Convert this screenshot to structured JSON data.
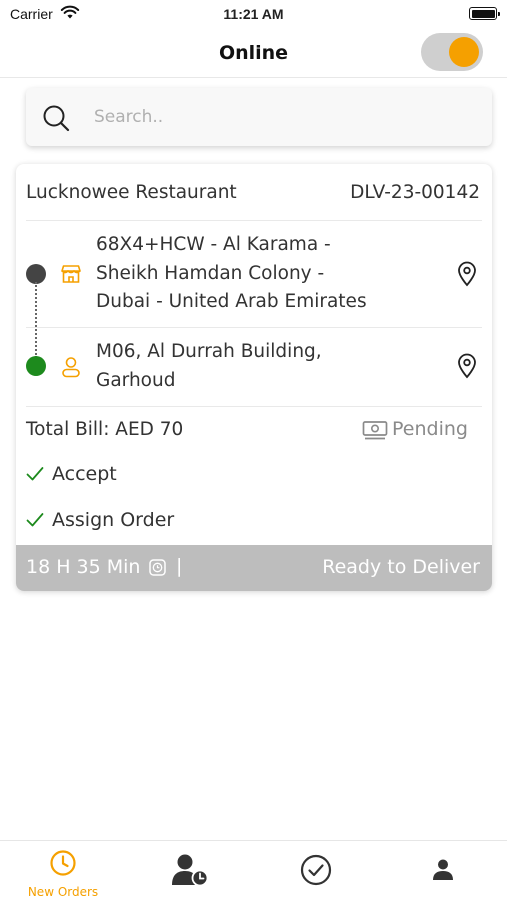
{
  "status_bar": {
    "carrier": "Carrier",
    "time": "11:21 AM"
  },
  "header": {
    "title": "Online",
    "toggle_on": true
  },
  "search": {
    "placeholder": "Search.."
  },
  "order": {
    "restaurant": "Lucknowee Restaurant",
    "order_id": "DLV-23-00142",
    "pickup_address_lines": [
      "68X4+HCW - Al Karama -",
      "Sheikh Hamdan Colony -",
      "Dubai - United Arab Emirates"
    ],
    "drop_address_lines": [
      "M06, Al Durrah Building,",
      "Garhoud"
    ],
    "total_bill": "Total Bill: AED 70",
    "payment_status": "Pending",
    "actions": [
      "Accept",
      "Assign Order"
    ],
    "elapsed_time": "18 H 35 Min",
    "separator": "|",
    "delivery_status": "Ready to Deliver"
  },
  "bottom_nav": {
    "items": [
      {
        "label": "New Orders",
        "icon": "clock-icon",
        "active": true
      },
      {
        "label": "",
        "icon": "user-clock-icon",
        "active": false
      },
      {
        "label": "",
        "icon": "check-circle-icon",
        "active": false
      },
      {
        "label": "",
        "icon": "person-icon",
        "active": false
      }
    ]
  },
  "colors": {
    "accent": "#f5a000",
    "pickup_dot": "#444444",
    "drop_dot": "#1d8a1d",
    "check": "#1d8a1d",
    "footer_bar": "#bdbdbd"
  }
}
